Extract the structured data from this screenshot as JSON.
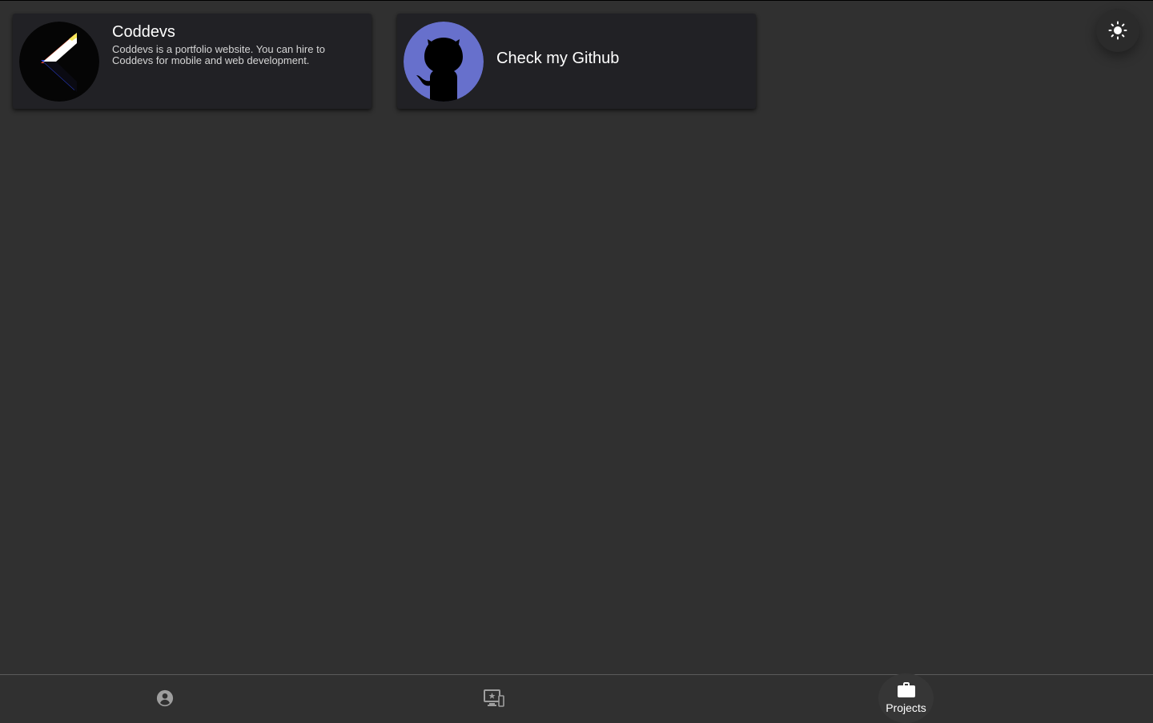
{
  "cards": [
    {
      "title": "Coddevs",
      "description": "Coddevs is a portfolio website. You can hire to Coddevs for mobile and web development."
    },
    {
      "title": "Check my Github",
      "avatar_color": "#6770cc"
    }
  ],
  "theme_toggle": {
    "icon": "sun-icon"
  },
  "bottom_nav": {
    "items": [
      {
        "icon": "account-circle-icon",
        "label": ""
      },
      {
        "icon": "monitor-star-icon",
        "label": ""
      },
      {
        "icon": "briefcase-icon",
        "label": "Projects",
        "active": true
      }
    ]
  },
  "colors": {
    "background": "#303030",
    "card": "#212125",
    "github_avatar": "#6770cc",
    "text_primary": "#ffffff",
    "icon_inactive": "#9e9e9e"
  }
}
